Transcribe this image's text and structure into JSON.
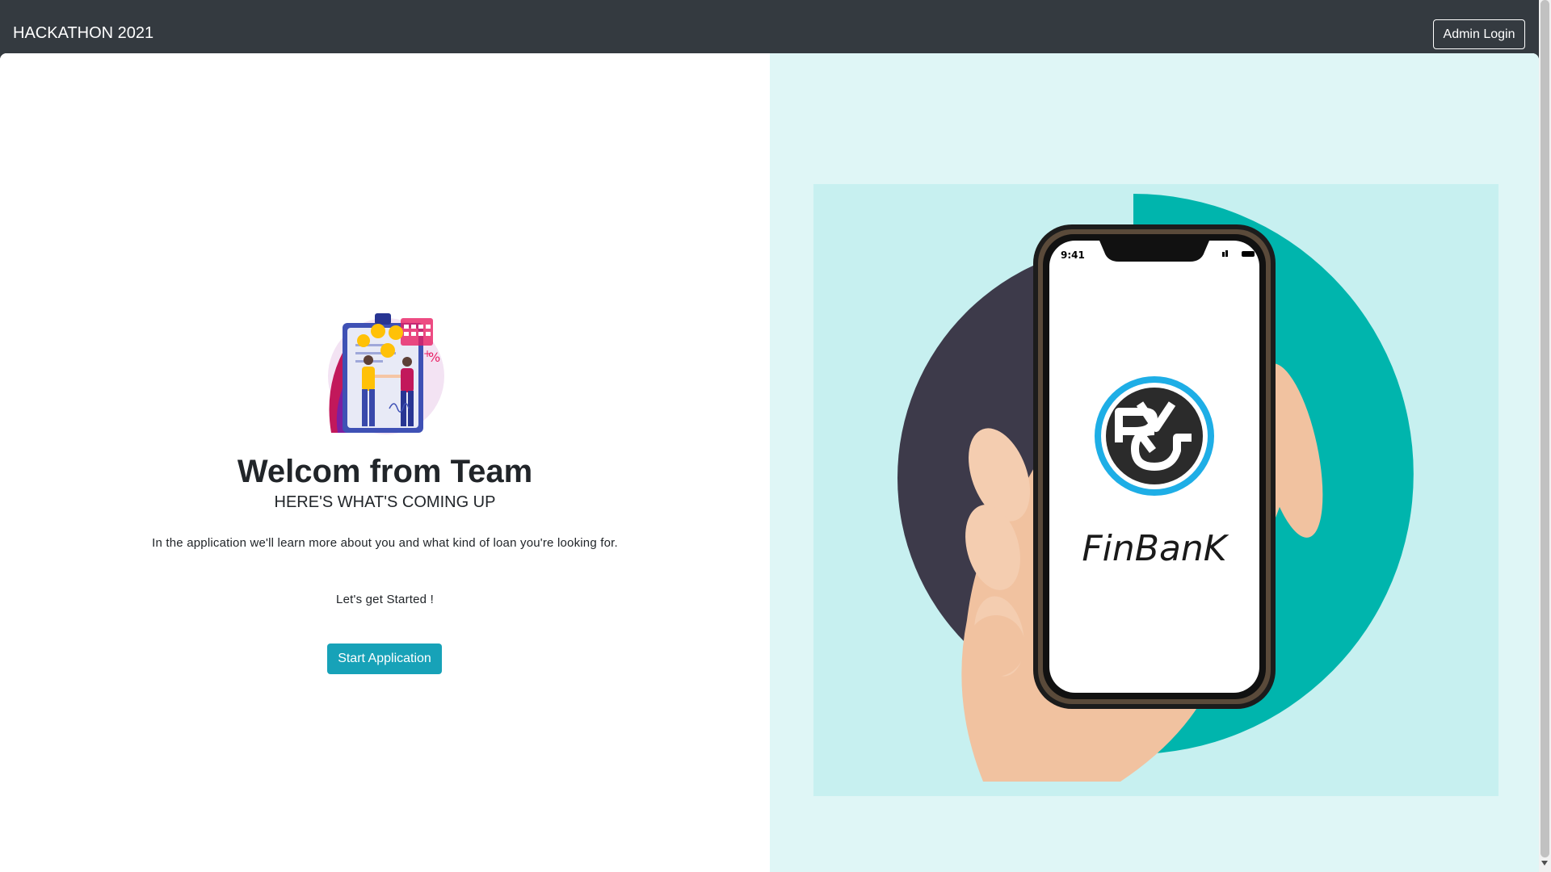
{
  "navbar": {
    "brand": "HACKATHON 2021",
    "admin_login_label": "Admin Login"
  },
  "welcome": {
    "title": "Welcom from Team",
    "subtitle": "HERE'S WHAT'S COMING UP",
    "description": "In the application we'll learn more about you and what kind of loan you're looking for.",
    "started_text": "Let's get Started !",
    "start_button_label": "Start Application"
  },
  "hero": {
    "phone_time": "9:41",
    "logo_text": "FinBanK"
  },
  "colors": {
    "navbar_bg": "#343a40",
    "accent": "#17a2b8",
    "hero_teal": "#00b5ad",
    "hero_bg": "#dff6f6"
  },
  "icons": {
    "illustration": "loan-agreement-illustration",
    "phone": "smartphone-in-hand",
    "logo": "rvg-circle-logo"
  }
}
